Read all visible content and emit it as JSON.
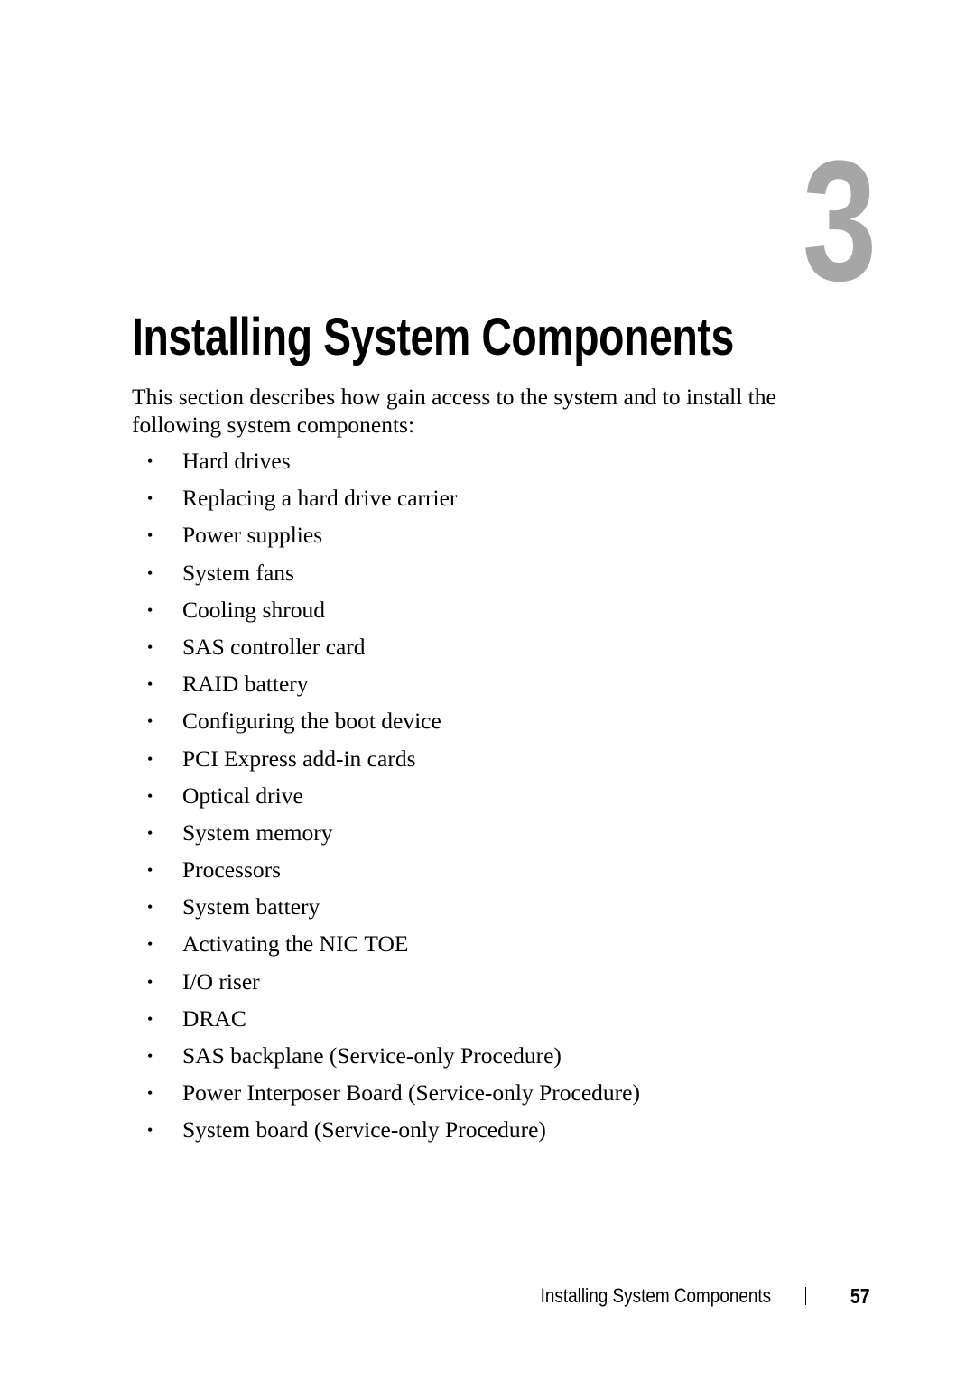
{
  "chapter": {
    "number": "3",
    "title": "Installing System Components"
  },
  "intro": "This section describes how gain access to the system and to install the following system components:",
  "bullet_glyph": "•",
  "items": [
    "Hard drives",
    "Replacing a hard drive carrier",
    "Power supplies",
    "System fans",
    "Cooling shroud",
    "SAS controller card",
    "RAID battery",
    "Configuring the boot device",
    "PCI Express add-in cards",
    "Optical drive",
    "System memory",
    "Processors",
    "System battery",
    "Activating the NIC TOE",
    "I/O riser",
    "DRAC",
    "SAS backplane (Service-only Procedure)",
    "Power Interposer Board (Service-only Procedure)",
    "System board (Service-only Procedure)"
  ],
  "footer": {
    "section_title": "Installing System Components",
    "page_number": "57"
  },
  "colors": {
    "chapter_number": "#a6a6a6",
    "text": "#000000",
    "background": "#ffffff"
  }
}
